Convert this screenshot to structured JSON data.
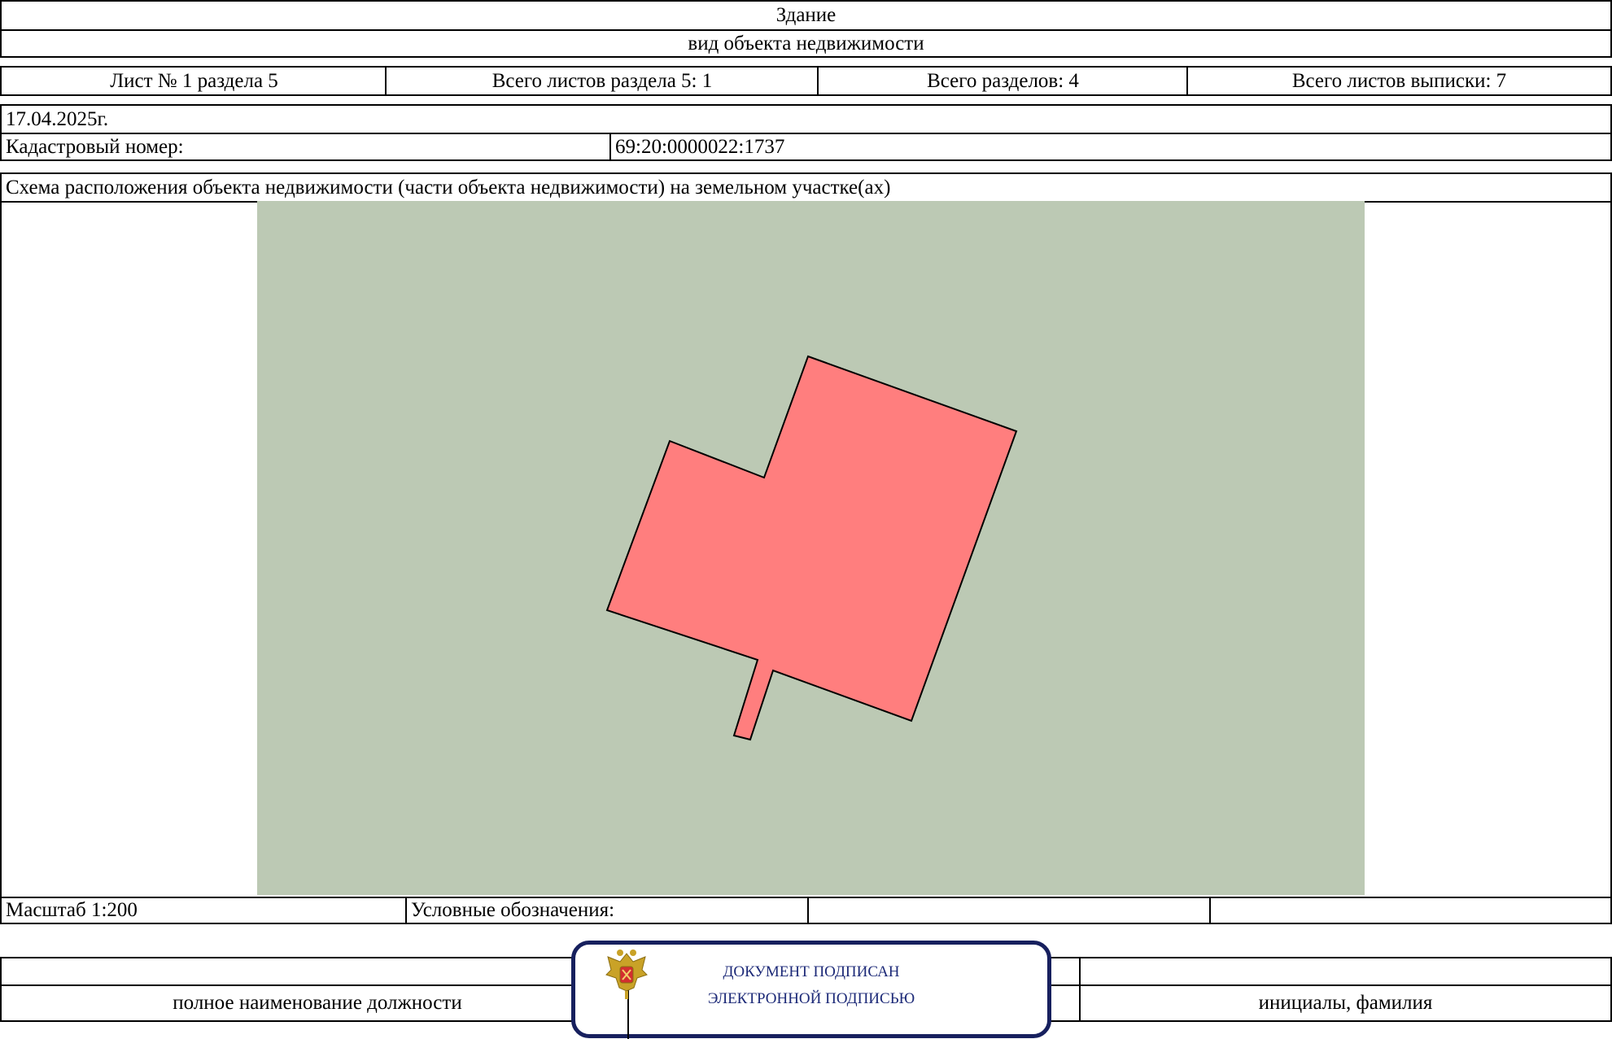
{
  "header": {
    "object_type": "Здание",
    "object_type_caption": "вид объекта недвижимости"
  },
  "sheet_info": {
    "sheet": "Лист № 1 раздела 5",
    "total_sheets_section": "Всего листов раздела 5: 1",
    "total_sections": "Всего разделов: 4",
    "total_sheets_extract": "Всего листов выписки: 7"
  },
  "record": {
    "date": "17.04.2025г.",
    "cadastral_label": "Кадастровый номер:",
    "cadastral_value": "69:20:0000022:1737"
  },
  "scheme": {
    "title": "Схема расположения объекта недвижимости (части объекта недвижимости) на земельном участке(ах)",
    "land_color": "#bcc9b4",
    "building_color": "#ff7e7e",
    "scale": "Масштаб 1:200",
    "legend_label": "Условные обозначения:"
  },
  "signature": {
    "position_caption": "полное наименование должности",
    "name_caption": "инициалы, фамилия",
    "stamp_line1": "ДОКУМЕНТ ПОДПИСАН",
    "stamp_line2": "ЭЛЕКТРОННОЙ ПОДПИСЬЮ",
    "stamp_color": "#17205e",
    "emblem_icon": "double-headed-eagle-emblem-icon"
  }
}
